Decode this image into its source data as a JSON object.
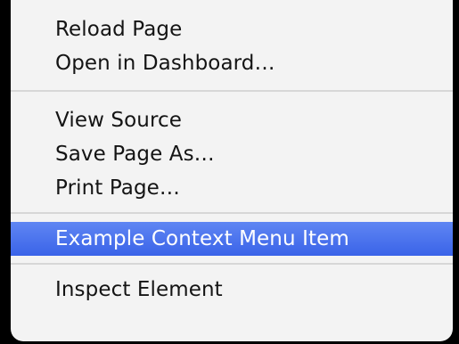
{
  "menu": {
    "groups": [
      [
        "Reload Page",
        "Open in Dashboard…"
      ],
      [
        "View Source",
        "Save Page As…",
        "Print Page…"
      ],
      [
        "Example Context Menu Item"
      ],
      [
        "Inspect Element"
      ]
    ],
    "selected": "Example Context Menu Item",
    "colors": {
      "highlight": "#3d66e9",
      "background": "#f3f3f3",
      "text": "#141414"
    }
  }
}
